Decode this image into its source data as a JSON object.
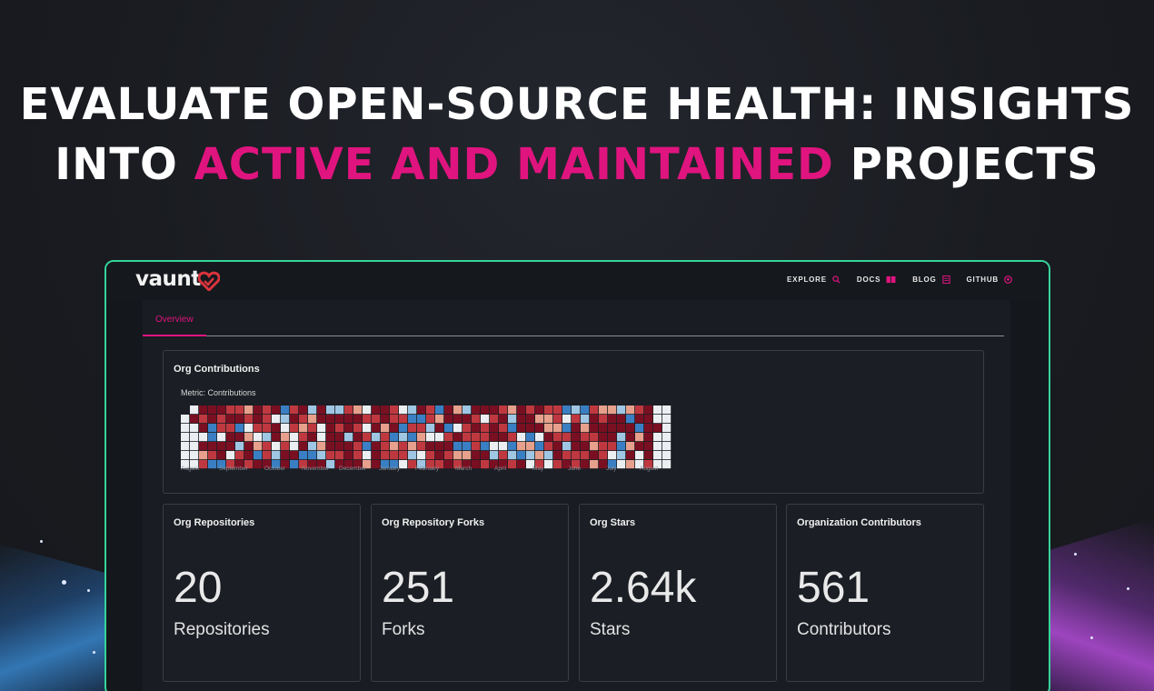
{
  "headline": {
    "line1": "EVALUATE OPEN-SOURCE HEALTH: INSIGHTS",
    "line2_pre": "INTO ",
    "line2_accent": "ACTIVE AND MAINTAINED",
    "line2_post": " PROJECTS"
  },
  "colors": {
    "accent": "#e0147f",
    "window_border": "#35d49a",
    "heat_dark": "#7a0f22",
    "heat_mid": "#c0383f",
    "heat_light": "#e7a08c",
    "heat_pale": "#eceff2",
    "heat_blue_light": "#9fc7e4",
    "heat_blue": "#3a7fc3"
  },
  "app": {
    "logo": "vaunt",
    "nav": [
      {
        "label": "EXPLORE",
        "icon": "search-icon"
      },
      {
        "label": "DOCS",
        "icon": "book-icon"
      },
      {
        "label": "BLOG",
        "icon": "document-icon"
      },
      {
        "label": "GITHUB",
        "icon": "github-icon"
      }
    ],
    "tabs": [
      {
        "label": "Overview"
      }
    ]
  },
  "contributions": {
    "title": "Org Contributions",
    "metric_label": "Metric: Contributions",
    "months": [
      "August",
      "September",
      "October",
      "November",
      "December",
      "January",
      "February",
      "March",
      "April",
      "May",
      "June",
      "July",
      "August"
    ]
  },
  "stats": [
    {
      "title": "Org Repositories",
      "value": "20",
      "unit": "Repositories"
    },
    {
      "title": "Org Repository Forks",
      "value": "251",
      "unit": "Forks"
    },
    {
      "title": "Org Stars",
      "value": "2.64k",
      "unit": "Stars"
    },
    {
      "title": "Organization Contributors",
      "value": "561",
      "unit": "Contributors"
    }
  ]
}
